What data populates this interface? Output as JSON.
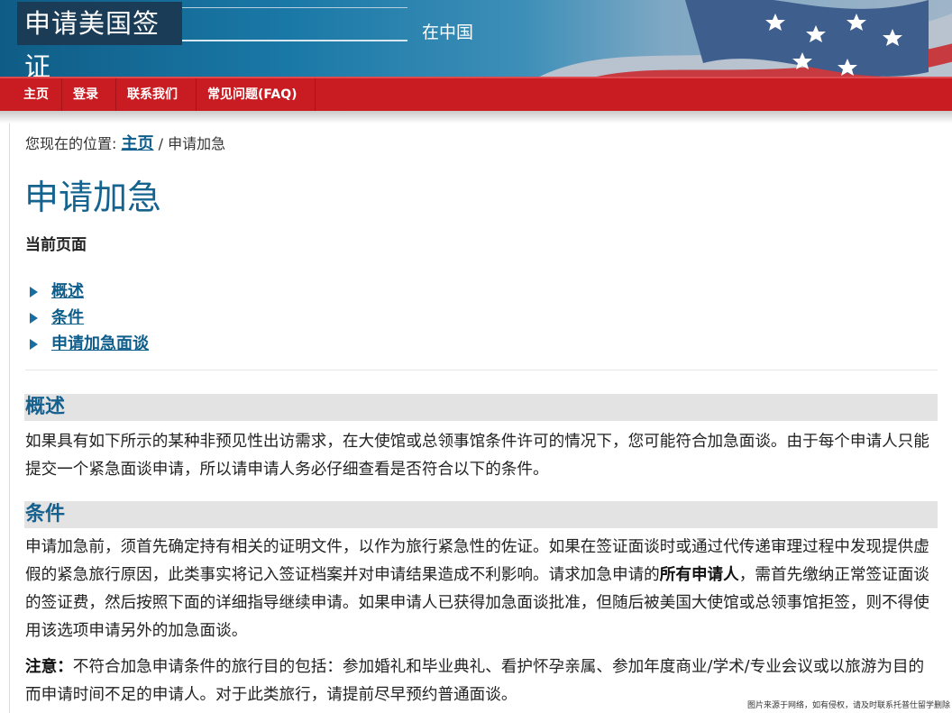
{
  "header": {
    "site_title": "申请美国签证",
    "country": "在中国"
  },
  "nav": {
    "items": [
      {
        "label": "主页"
      },
      {
        "label": "登录"
      },
      {
        "label": "联系我们"
      },
      {
        "label": "常见问题(FAQ)"
      }
    ]
  },
  "breadcrumb": {
    "prefix": "您现在的位置:",
    "home": "主页",
    "separator": "/",
    "current": "申请加急"
  },
  "page": {
    "title": "申请加急",
    "current_page_label": "当前页面"
  },
  "toc": [
    {
      "label": "概述"
    },
    {
      "label": "条件"
    },
    {
      "label": "申请加急面谈"
    }
  ],
  "overview": {
    "heading": "概述",
    "text": "如果具有如下所示的某种非预见性出访需求，在大使馆或总领事馆条件许可的情况下，您可能符合加急面谈。由于每个申请人只能提交一个紧急面谈申请，所以请申请人务必仔细查看是否符合以下的条件。"
  },
  "conditions": {
    "heading": "条件",
    "text_part1": "申请加急前，须首先确定持有相关的证明文件，以作为旅行紧急性的佐证。如果在签证面谈时或通过代传递审理过程中发现提供虚假的紧急旅行原因，此类事实将记入签证档案并对申请结果造成不利影响。请求加急申请的",
    "text_bold": "所有申请人",
    "text_part2": "，需首先缴纳正常签证面谈的签证费，然后按照下面的详细指导继续申请。如果申请人已获得加急面谈批准，但随后被美国大使馆或总领事馆拒签，则不得使用该选项申请另外的加急面谈。",
    "note_label": "注意：",
    "note_text": "不符合加急申请条件的旅行目的包括：参加婚礼和毕业典礼、看护怀孕亲属、参加年度商业/学术/专业会议或以旅游为目的而申请时间不足的申请人。对于此类旅行，请提前尽早预约普通面谈。"
  },
  "watermark": "图片来源于网络，如有侵权，请及时联系托普仕留学删除",
  "colors": {
    "nav_red": "#c81c22",
    "link_blue": "#0e5e8c",
    "heading_blue": "#15638f",
    "section_bg": "#e3e3e3"
  }
}
